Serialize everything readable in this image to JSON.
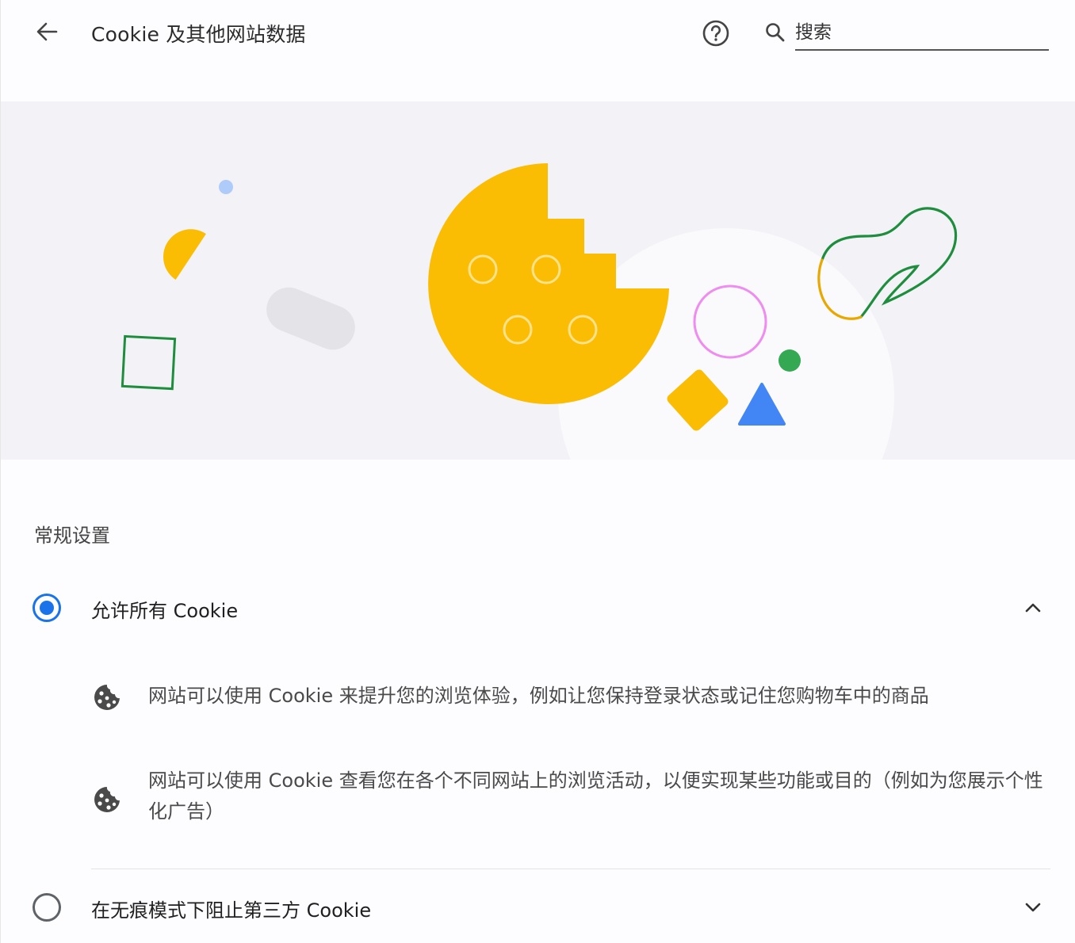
{
  "header": {
    "title": "Cookie 及其他网站数据",
    "search_placeholder": "搜索",
    "back_icon": "arrow-left-icon",
    "help_icon": "help-circle-icon",
    "search_icon": "search-icon"
  },
  "section": {
    "title": "常规设置"
  },
  "options": [
    {
      "label": "允许所有 Cookie",
      "selected": true,
      "expanded": true,
      "details": [
        "网站可以使用 Cookie 来提升您的浏览体验，例如让您保持登录状态或记住您购物车中的商品",
        "网站可以使用 Cookie 查看您在各个不同网站上的浏览活动，以便实现某些功能或目的（例如为您展示个性化广告）"
      ]
    },
    {
      "label": "在无痕模式下阻止第三方 Cookie",
      "selected": false,
      "expanded": false
    }
  ],
  "colors": {
    "accent": "#1a73e8",
    "cookie": "#fbbc04",
    "green": "#34a853",
    "blue": "#4285f4",
    "pink": "#ee8cf0"
  }
}
